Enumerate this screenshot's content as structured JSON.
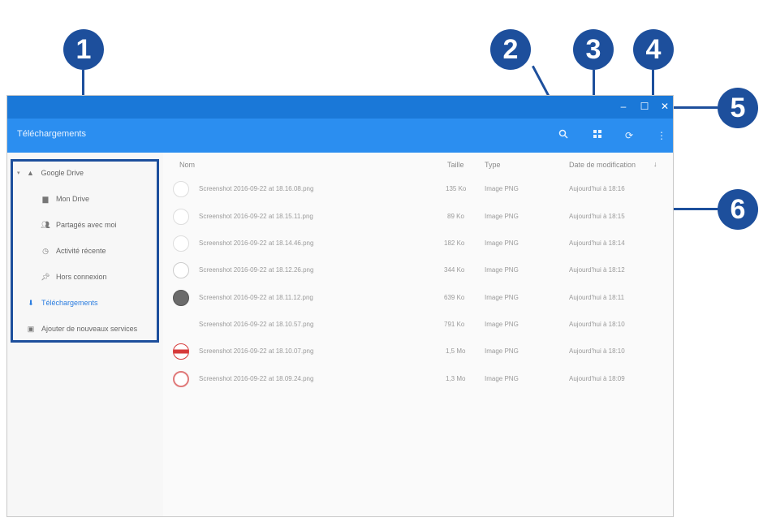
{
  "window": {
    "title": "Téléchargements"
  },
  "toolbar": {
    "icons": [
      "search-icon",
      "view-grid-icon",
      "sort-icon",
      "more-vertical-icon"
    ]
  },
  "sidebar": {
    "items": [
      {
        "label": "Google Drive",
        "icon": "drive-icon"
      },
      {
        "label": "Mon Drive",
        "icon": "folder-icon"
      },
      {
        "label": "Partagés avec moi",
        "icon": "people-icon"
      },
      {
        "label": "Activité récente",
        "icon": "clock-icon"
      },
      {
        "label": "Hors connexion",
        "icon": "pin-icon"
      },
      {
        "label": "Téléchargements",
        "icon": "download-icon",
        "active": true
      },
      {
        "label": "Ajouter de nouveaux services",
        "icon": "add-icon"
      }
    ]
  },
  "table": {
    "headers": [
      "Nom",
      "Taille",
      "Type",
      "Date de modification"
    ],
    "rows": [
      {
        "name": "Screenshot 2016-09-22 at 18.16.08.png",
        "size": "135 Ko",
        "type": "Image PNG",
        "date": "Aujourd'hui à 18:16"
      },
      {
        "name": "Screenshot 2016-09-22 at 18.15.11.png",
        "size": "89 Ko",
        "type": "Image PNG",
        "date": "Aujourd'hui à 18:15"
      },
      {
        "name": "Screenshot 2016-09-22 at 18.14.46.png",
        "size": "182 Ko",
        "type": "Image PNG",
        "date": "Aujourd'hui à 18:14"
      },
      {
        "name": "Screenshot 2016-09-22 at 18.12.26.png",
        "size": "344 Ko",
        "type": "Image PNG",
        "date": "Aujourd'hui à 18:12"
      },
      {
        "name": "Screenshot 2016-09-22 at 18.11.12.png",
        "size": "639 Ko",
        "type": "Image PNG",
        "date": "Aujourd'hui à 18:11"
      },
      {
        "name": "Screenshot 2016-09-22 at 18.10.57.png",
        "size": "791 Ko",
        "type": "Image PNG",
        "date": "Aujourd'hui à 18:10"
      },
      {
        "name": "Screenshot 2016-09-22 at 18.10.07.png",
        "size": "1,5 Mo",
        "type": "Image PNG",
        "date": "Aujourd'hui à 18:10"
      },
      {
        "name": "Screenshot 2016-09-22 at 18.09.24.png",
        "size": "1,3 Mo",
        "type": "Image PNG",
        "date": "Aujourd'hui à 18:09"
      }
    ]
  },
  "callouts": [
    "1",
    "2",
    "3",
    "4",
    "5",
    "6"
  ],
  "colors": {
    "titlebar": "#1a78d8",
    "toolbar": "#2b8ef0",
    "callout": "#1d4f9c",
    "active": "#2b7de0"
  }
}
